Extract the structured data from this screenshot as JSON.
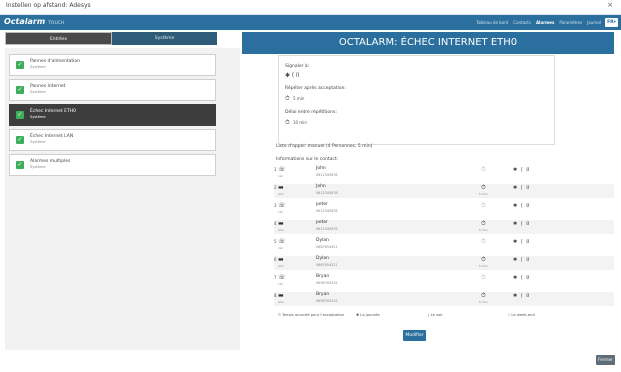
{
  "window": {
    "title": "Instellen op afstand: Adesys",
    "close": "×"
  },
  "header": {
    "logo": "Octalarm",
    "logo_sub": "TOUCH",
    "nav": [
      "Tableau de bord",
      "Contacts",
      "Alarmes",
      "Paramètres",
      "Journal"
    ],
    "nav_current": 2,
    "lang": "FR▾"
  },
  "tabs": {
    "left": "Entrées",
    "right": "Système"
  },
  "page_title": "OCTALARM: ÉCHEC INTERNET ETH0",
  "alarm_list": [
    {
      "title": "Pannes d'alimentation",
      "sub": "Système"
    },
    {
      "title": "Pannes Internet",
      "sub": "Système"
    },
    {
      "title": "Échec Internet ETH0",
      "sub": "Système",
      "active": true
    },
    {
      "title": "Échec Internet LAN",
      "sub": "Système"
    },
    {
      "title": "Alarmes multiples",
      "sub": "Système"
    }
  ],
  "settings": {
    "signaler_label": "Signaler à:",
    "signaler_options": "✱ ( ⌷",
    "repeter_label": "Répéter après acceptation:",
    "repeter_value": "5 min",
    "delai_label": "Délai entre répétitions:",
    "delai_value": "10 min"
  },
  "call_list": "Liste d'appel: manuel (4 Personnes, 5 min)",
  "contacts_header": "Informations sur le contact:",
  "contacts": [
    {
      "n": "1",
      "device": "phone",
      "dev_label": "call",
      "name": "John",
      "phone": "0612345678",
      "clock_active": false,
      "delay": ""
    },
    {
      "n": "2",
      "device": "sms",
      "dev_label": "sms",
      "name": "John",
      "phone": "0612345678",
      "clock_active": true,
      "delay": "5 min"
    },
    {
      "n": "3",
      "device": "phone",
      "dev_label": "call",
      "name": "peter",
      "phone": "0612345678",
      "clock_active": false,
      "delay": ""
    },
    {
      "n": "4",
      "device": "sms",
      "dev_label": "sms",
      "name": "peter",
      "phone": "0612345678",
      "clock_active": true,
      "delay": "5 min"
    },
    {
      "n": "5",
      "device": "phone",
      "dev_label": "call",
      "name": "Dylan",
      "phone": "0687654321",
      "clock_active": false,
      "delay": ""
    },
    {
      "n": "6",
      "device": "sms",
      "dev_label": "sms",
      "name": "Dylan",
      "phone": "0687654321",
      "clock_active": true,
      "delay": "5 min"
    },
    {
      "n": "7",
      "device": "phone",
      "dev_label": "call",
      "name": "Bryan",
      "phone": "0698765432",
      "clock_active": false,
      "delay": ""
    },
    {
      "n": "8",
      "device": "sms",
      "dev_label": "sms",
      "name": "Bryan",
      "phone": "0698765432",
      "clock_active": true,
      "delay": "5 min"
    }
  ],
  "legend": {
    "temps": "Temps accordé pour l'acceptation",
    "journee": "La journée",
    "soir": "Le soir",
    "weekend": "Le week-end"
  },
  "buttons": {
    "modifier": "Modifier",
    "fermer": "Fermer"
  },
  "colors": {
    "header": "#2a6f9d",
    "active_card": "#3d3d3d",
    "check": "#3cae5c"
  }
}
